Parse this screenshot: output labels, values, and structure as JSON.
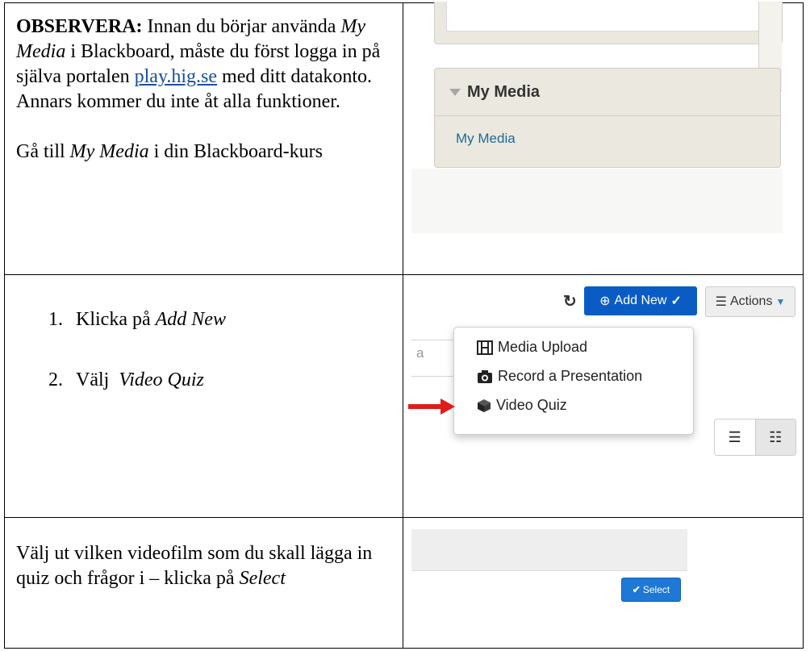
{
  "rows": [
    {
      "text": {
        "bold_lead": "OBSERVERA:",
        "p1_a": " Innan du börjar använda ",
        "p1_italic": "My Media",
        "p1_b": " i Blackboard, måste du först logga in på själva portalen ",
        "link": "play.hig.se",
        "p1_c": " med ditt datakonto. Annars kommer du inte åt alla funktioner.",
        "p2_a": "Gå till ",
        "p2_italic": "My Media",
        "p2_b": " i din Blackboard-kurs"
      },
      "screenshot": {
        "box_title": "My Media",
        "box_link": "My Media"
      }
    },
    {
      "steps": [
        {
          "num": "1.",
          "text": "Klicka på ",
          "italic": "Add New"
        },
        {
          "num": "2.",
          "text": "Välj  ",
          "italic": "Video Quiz"
        }
      ],
      "screenshot": {
        "add_new_label": "Add New",
        "actions_label": "Actions",
        "search_fragment": "a",
        "menu_items": [
          {
            "label": "Media Upload",
            "icon": "film-icon"
          },
          {
            "label": "Record a Presentation",
            "icon": "camera-icon"
          },
          {
            "label": "Video Quiz",
            "icon": "cube-icon"
          }
        ],
        "arrow_color": "#e01b1b"
      }
    },
    {
      "text": {
        "a": "Välj ut vilken videofilm som du skall lägga in quiz och frågor i – klicka på ",
        "italic": "Select"
      },
      "screenshot": {
        "select_label": "Select",
        "select_color": "#1e78d6"
      }
    }
  ]
}
